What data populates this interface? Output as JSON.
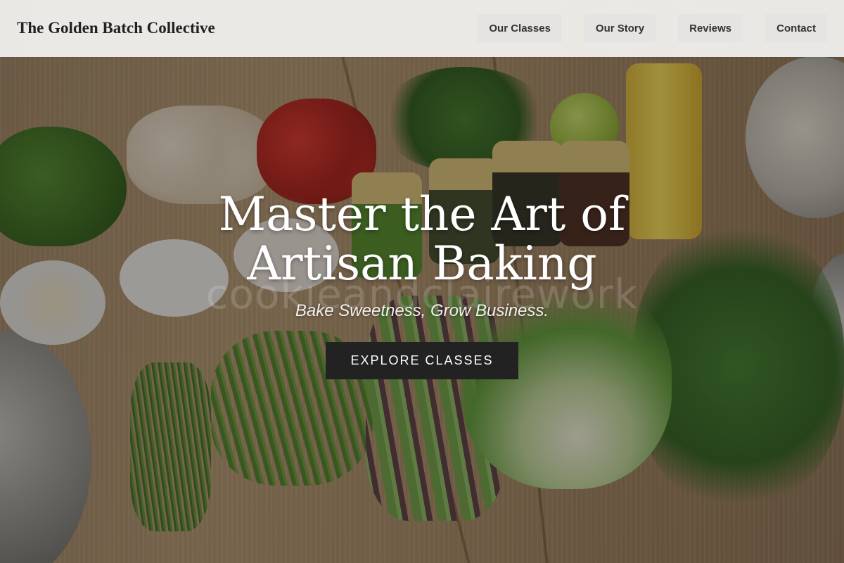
{
  "header": {
    "brand": "The Golden Batch Collective",
    "nav": [
      {
        "label": "Our Classes"
      },
      {
        "label": "Our Story"
      },
      {
        "label": "Reviews"
      },
      {
        "label": "Contact"
      }
    ]
  },
  "hero": {
    "title": "Master the Art of Artisan Baking",
    "tagline": "Bake Sweetness, Grow Business.",
    "cta_label": "EXPLORE CLASSES",
    "watermark": "cookieandclairework"
  },
  "colors": {
    "cta_background": "#222222",
    "nav_background": "#f4f3f1",
    "nav_button_background": "#e5e4e2"
  }
}
